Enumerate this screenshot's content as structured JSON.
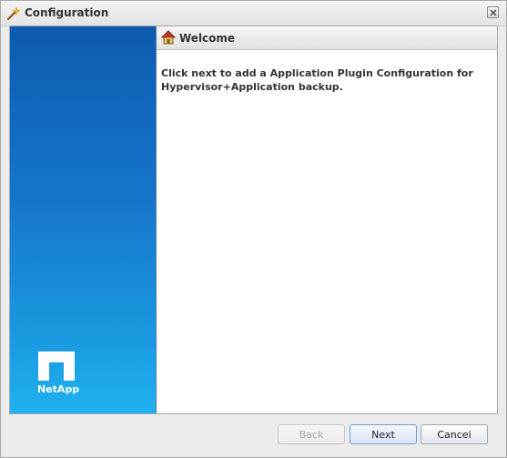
{
  "window": {
    "title": "Configuration",
    "title_icon": "wizard-wand-icon",
    "close_icon": "close-icon"
  },
  "side_panel": {
    "logo_icon": "netapp-logo",
    "logo_text": "NetApp",
    "gradient_top": "#0d5bb0",
    "gradient_bottom": "#1fb1ef"
  },
  "header": {
    "icon": "home-icon",
    "title": "Welcome"
  },
  "body": {
    "message": "Click next to add a Application Plugin Configuration for Hypervisor+Application backup."
  },
  "buttons": {
    "back": "Back",
    "back_disabled": true,
    "next": "Next",
    "cancel": "Cancel"
  }
}
